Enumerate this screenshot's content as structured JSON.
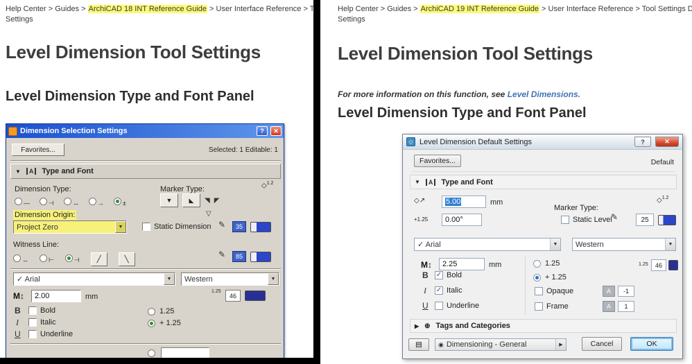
{
  "icons": {
    "collapse": "▼",
    "expand": "▶",
    "dropdown": "▼",
    "check": "✓",
    "close": "✕",
    "help": "?",
    "text_size": "M↕",
    "pencil": "✎",
    "eye": "◉",
    "pen_set": "▤",
    "tag": "⊕",
    "panel_a": "A",
    "marker_down": "▼",
    "marker_corner": "◢",
    "marker_up_left": "◤",
    "marker_up_right": "◥",
    "marker_open": "▽",
    "marker_left": "◣",
    "diamond": "◇",
    "arrow_ne": "↗",
    "slash": "╱",
    "backslash": "╲",
    "b": "B",
    "i": "I",
    "u": "U"
  },
  "left_page": {
    "breadcrumb": {
      "prefix": "Help Center > Guides > ",
      "highlight": "ArchiCAD 18 INT Reference Guide",
      "suffix": " > User Interface Reference > Tool Setti",
      "line2": "Settings"
    },
    "title": "Level Dimension Tool Settings",
    "subtitle": "Level Dimension Type and Font Panel",
    "dialog": {
      "title": "Dimension Selection Settings",
      "favorites_button": "Favorites...",
      "selected_status": "Selected: 1 Editable: 1",
      "type_font_panel": "Type and Font",
      "dimension_type_label": "Dimension Type:",
      "marker_type_label": "Marker Type:",
      "dim_type_glyphs": [
        "—",
        "⊣",
        "↔",
        "→",
        "±"
      ],
      "marker_superscript": "1.2",
      "dimension_origin_label": "Dimension Origin:",
      "dimension_origin_value": "Project Zero",
      "static_dimension_label": "Static Dimension",
      "pen_value_1": "35",
      "witness_line_label": "Witness Line:",
      "witness_glyphs": [
        "↔",
        "⊢",
        "⊣"
      ],
      "pen_value_2": "85",
      "font_name": "Arial",
      "font_script": "Western",
      "text_size_value": "2.00",
      "text_size_unit": "mm",
      "bold_label": "Bold",
      "italic_label": "Italic",
      "underline_label": "Underline",
      "ratio_option_1": "1.25",
      "ratio_option_2": "+ 1.25",
      "superscript_ratio": "1.25",
      "font_pen_value": "46"
    }
  },
  "right_page": {
    "breadcrumb": {
      "prefix": "Help Center > Guides > ",
      "highlight": "ArchiCAD 19 INT Reference Guide",
      "suffix": " > User Interface Reference > Tool Settings Dialog Bo",
      "line2": "Settings"
    },
    "title": "Level Dimension Tool Settings",
    "note_prefix": "For more information on this function, see ",
    "note_link": "Level Dimensions.",
    "subtitle": "Level Dimension Type and Font Panel",
    "dialog": {
      "title": "Level Dimension Default Settings",
      "favorites_button": "Favorites...",
      "default_status": "Default",
      "type_font_panel": "Type and Font",
      "marker_size_value": "5.00",
      "marker_size_unit": "mm",
      "marker_type_label": "Marker Type:",
      "marker_superscript": "1.2",
      "plus_ratio_icon": "+1.25",
      "angle_value": "0.00°",
      "static_level_label": "Static Level",
      "marker_pen_value": "25",
      "font_name": "Arial",
      "font_script": "Western",
      "text_size_value": "2.25",
      "text_size_unit": "mm",
      "bold_label": "Bold",
      "italic_label": "Italic",
      "underline_label": "Underline",
      "ratio_option_1": "1.25",
      "ratio_option_2": "+ 1.25",
      "superscript_ratio": "1.25",
      "font_pen_value": "46",
      "opaque_label": "Opaque",
      "frame_label": "Frame",
      "color_chip": "A",
      "opaque_pen_value": "-1",
      "frame_pen_value": "1",
      "tags_panel": "Tags and Categories",
      "layer_value": "Dimensioning - General",
      "cancel_button": "Cancel",
      "ok_button": "OK"
    }
  }
}
